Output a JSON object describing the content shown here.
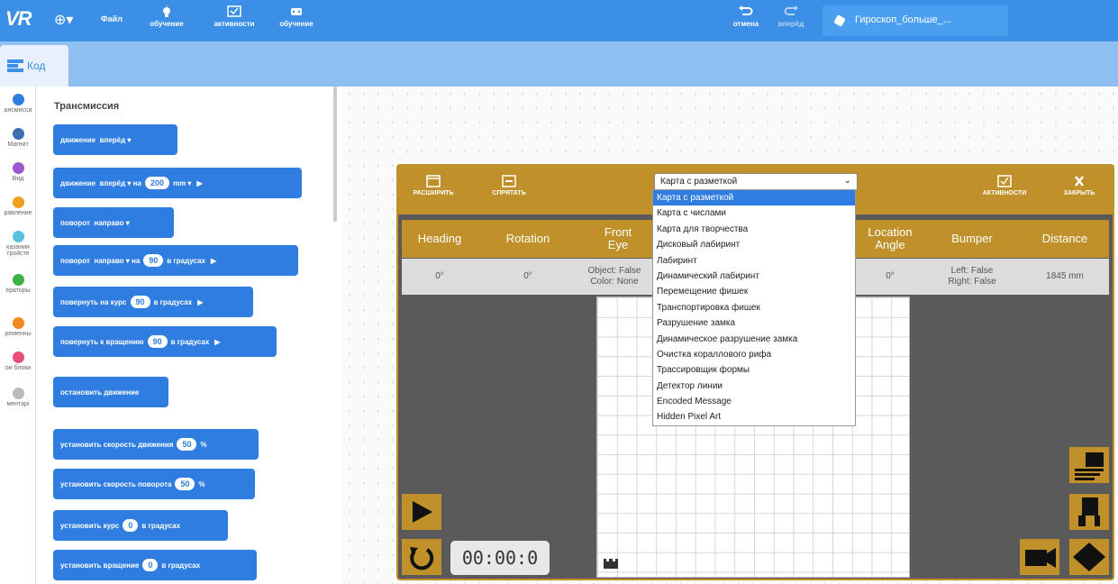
{
  "colors": {
    "topbar": "#3b8fe6",
    "subbar": "#8dbff0",
    "block": "#2f7de0",
    "sim_frame": "#c0912a",
    "sim_body": "#5a5a5a"
  },
  "topbar": {
    "logo": "VR",
    "file_menu": "Файл",
    "items": [
      {
        "label": "обучение",
        "icon": "lightbulb-icon"
      },
      {
        "label": "активности",
        "icon": "checklist-icon"
      },
      {
        "label": "обучение",
        "icon": "robot-icon"
      }
    ],
    "undo_label": "отмена",
    "redo_label": "вперёд",
    "project_name": "Гироскоп_больше_..."
  },
  "subbar": {
    "code_tab": "Код"
  },
  "categories": [
    {
      "label": "ансмисси",
      "color": "#2f7de0"
    },
    {
      "label": "Магнит",
      "color": "#3c6fb0"
    },
    {
      "label": "Вид",
      "color": "#9b59d0"
    },
    {
      "label": "равление",
      "color": "#f0a020"
    },
    {
      "label": "казания тройсте",
      "color": "#5bc0de"
    },
    {
      "label": "ераторы",
      "color": "#3cb043"
    },
    {
      "label": "ременны",
      "color": "#f08a20"
    },
    {
      "label": "ои блоки",
      "color": "#e8507a"
    },
    {
      "label": "ментарі",
      "color": "#bbbbbb"
    }
  ],
  "palette": {
    "title": "Трансмиссия",
    "blocks": [
      {
        "text1": "движение",
        "text2": "вперёд ▾",
        "pill": "",
        "text3": "",
        "arrow": ""
      },
      {
        "text1": "движение",
        "text2": "вперёд ▾  на",
        "pill": "200",
        "text3": "mm ▾",
        "arrow": "▶"
      },
      {
        "text1": "поворот",
        "text2": "направо ▾",
        "pill": "",
        "text3": "",
        "arrow": ""
      },
      {
        "text1": "поворот",
        "text2": "направо ▾  на",
        "pill": "90",
        "text3": "в градусах",
        "arrow": "▶"
      },
      {
        "text1": "повернуть на курс",
        "text2": "",
        "pill": "90",
        "text3": "в градусах",
        "arrow": "▶"
      },
      {
        "text1": "повернуть к вращению",
        "text2": "",
        "pill": "90",
        "text3": "в градусах",
        "arrow": "▶"
      },
      {
        "text1": "остановить движение",
        "text2": "",
        "pill": "",
        "text3": "",
        "arrow": ""
      },
      {
        "text1": "установить скорость движения",
        "text2": "",
        "pill": "50",
        "text3": "%",
        "arrow": ""
      },
      {
        "text1": "установить скорость поворота",
        "text2": "",
        "pill": "50",
        "text3": "%",
        "arrow": ""
      },
      {
        "text1": "установить курс",
        "text2": "",
        "pill": "0",
        "text3": "в градусах",
        "arrow": ""
      },
      {
        "text1": "установить вращение",
        "text2": "",
        "pill": "0",
        "text3": "в градусах",
        "arrow": ""
      }
    ]
  },
  "sim": {
    "expand_label": "РАСШИРИТЬ",
    "hide_label": "СПРЯТАТЬ",
    "activities_label": "АКТИВНОСТИ",
    "close_label": "ЗАКРЫТЬ",
    "selected_map": "Карта с разметкой",
    "map_options": [
      "Карта с разметкой",
      "Карта с числами",
      "Карта для творчества",
      "Дисковый лабиринт",
      "Лабиринт",
      "Динамический лабиринт",
      "Перемещение фишек",
      "Транспортировка фишек",
      "Разрушение замка",
      "Динамическое разрушение замка",
      "Очистка кораллового рифа",
      "Трассировщик формы",
      "Детектор линии",
      "Encoded Message",
      "Hidden Pixel Art"
    ],
    "sensor_headers": {
      "heading": "Heading",
      "rotation": "Rotation",
      "front_eye": "Front\nEye",
      "location_angle": "Location\nAngle",
      "bumper": "Bumper",
      "distance": "Distance"
    },
    "sensor_values": {
      "heading": "0°",
      "rotation": "0°",
      "front_eye": "Object: False\nColor: None",
      "location_angle": "0°",
      "bumper": "Left: False\nRight: False",
      "distance": "1845 mm"
    },
    "timer": "00:00:0"
  }
}
